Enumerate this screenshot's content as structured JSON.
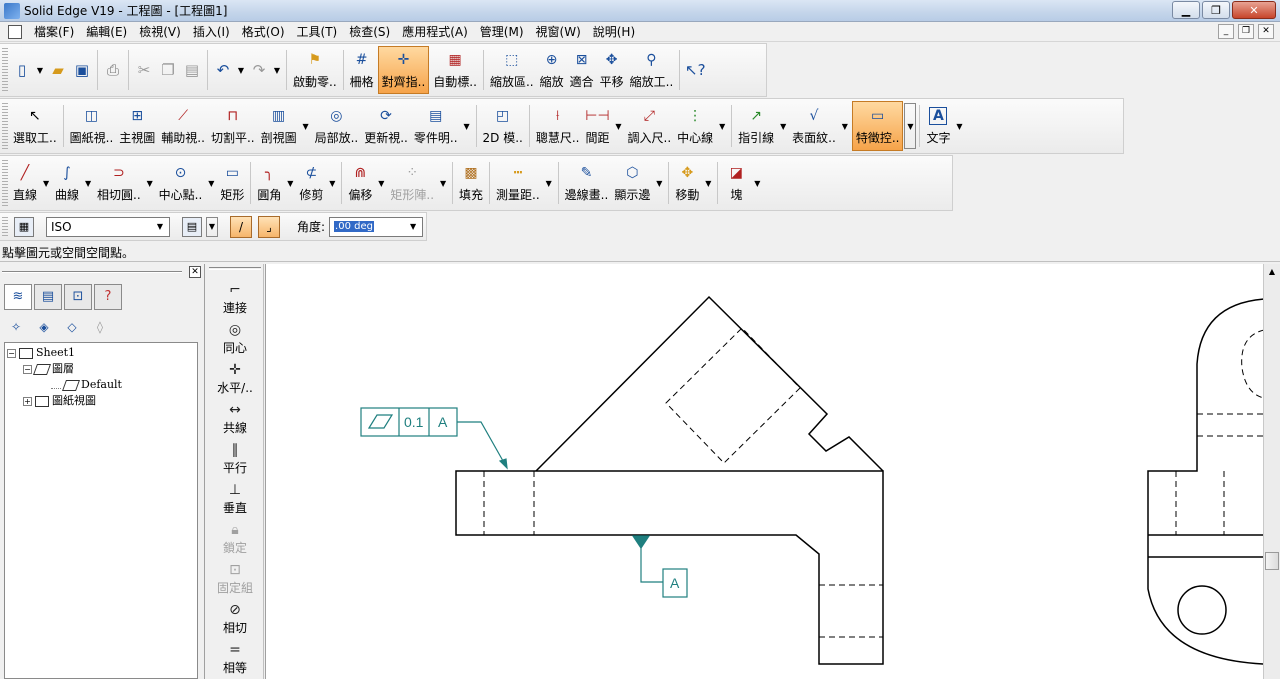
{
  "window": {
    "title": "Solid Edge V19 - 工程圖 - [工程圖1]"
  },
  "menu": [
    "檔案(F)",
    "編輯(E)",
    "檢視(V)",
    "插入(I)",
    "格式(O)",
    "工具(T)",
    "檢查(S)",
    "應用程式(A)",
    "管理(M)",
    "視窗(W)",
    "說明(H)"
  ],
  "toolbar1": {
    "buttons": [
      {
        "label": "啟動零..",
        "icon": "flag-icon"
      },
      {
        "label": "柵格",
        "icon": "grid-icon"
      },
      {
        "label": "對齊指..",
        "icon": "align-indicator-icon",
        "active": true
      },
      {
        "label": "自動標..",
        "icon": "auto-label-icon"
      },
      {
        "label": "縮放區..",
        "icon": "zoom-area-icon"
      },
      {
        "label": "縮放",
        "icon": "zoom-icon"
      },
      {
        "label": "適合",
        "icon": "fit-icon"
      },
      {
        "label": "平移",
        "icon": "pan-icon"
      },
      {
        "label": "縮放工..",
        "icon": "zoom-tool-icon"
      }
    ]
  },
  "toolbar2": {
    "buttons": [
      {
        "label": "選取工..",
        "icon": "select-tool-icon"
      },
      {
        "label": "圖紙視..",
        "icon": "drawing-view-icon"
      },
      {
        "label": "主視圖",
        "icon": "principal-view-icon"
      },
      {
        "label": "輔助視..",
        "icon": "auxiliary-view-icon"
      },
      {
        "label": "切割平..",
        "icon": "cutting-plane-icon"
      },
      {
        "label": "剖視圖",
        "icon": "section-view-icon"
      },
      {
        "label": "局部放..",
        "icon": "detail-view-icon"
      },
      {
        "label": "更新視..",
        "icon": "update-view-icon"
      },
      {
        "label": "零件明..",
        "icon": "parts-list-icon"
      },
      {
        "label": "2D 模..",
        "icon": "2d-model-icon"
      },
      {
        "label": "聰慧尺..",
        "icon": "smart-dimension-icon"
      },
      {
        "label": "間距",
        "icon": "distance-icon"
      },
      {
        "label": "調入尺..",
        "icon": "retrieve-dimension-icon"
      },
      {
        "label": "中心線",
        "icon": "center-line-icon"
      },
      {
        "label": "指引線",
        "icon": "leader-icon"
      },
      {
        "label": "表面紋..",
        "icon": "surface-texture-icon"
      },
      {
        "label": "特徵控..",
        "icon": "feature-control-icon",
        "active": true
      },
      {
        "label": "文字",
        "icon": "text-icon"
      }
    ]
  },
  "toolbar3": {
    "buttons": [
      {
        "label": "直線",
        "icon": "line-icon"
      },
      {
        "label": "曲線",
        "icon": "curve-icon"
      },
      {
        "label": "相切圓..",
        "icon": "tangent-arc-icon"
      },
      {
        "label": "中心點..",
        "icon": "center-point-icon"
      },
      {
        "label": "矩形",
        "icon": "rectangle-icon"
      },
      {
        "label": "圓角",
        "icon": "fillet-icon"
      },
      {
        "label": "修剪",
        "icon": "trim-icon"
      },
      {
        "label": "偏移",
        "icon": "offset-icon"
      },
      {
        "label": "矩形陣..",
        "icon": "rectangular-pattern-icon",
        "disabled": true
      },
      {
        "label": "填充",
        "icon": "fill-icon"
      },
      {
        "label": "測量距..",
        "icon": "measure-distance-icon"
      },
      {
        "label": "邊線畫..",
        "icon": "edge-painter-icon"
      },
      {
        "label": "顯示邊",
        "icon": "show-edges-icon"
      },
      {
        "label": "移動",
        "icon": "move-icon"
      },
      {
        "label": "塊",
        "icon": "block-icon"
      }
    ]
  },
  "ribbon": {
    "style_value": "ISO",
    "angle_label": "角度:",
    "angle_value": ".00 deg"
  },
  "prompt": "點擊圖元或空間空間點。",
  "tree": {
    "root": "Sheet1",
    "layers": "圖層",
    "default": "Default",
    "views": "圖紙視圖"
  },
  "relationships": [
    {
      "label": "連接",
      "icon": "connect-icon"
    },
    {
      "label": "同心",
      "icon": "concentric-icon"
    },
    {
      "label": "水平/..",
      "icon": "horizontal-vertical-icon"
    },
    {
      "label": "共線",
      "icon": "collinear-icon"
    },
    {
      "label": "平行",
      "icon": "parallel-icon"
    },
    {
      "label": "垂直",
      "icon": "perpendicular-icon"
    },
    {
      "label": "鎖定",
      "icon": "lock-icon",
      "disabled": true
    },
    {
      "label": "固定組",
      "icon": "rigid-set-icon",
      "disabled": true
    },
    {
      "label": "相切",
      "icon": "tangent-icon"
    },
    {
      "label": "相等",
      "icon": "equal-icon"
    }
  ],
  "drawing": {
    "fcf_tolerance": "0.1",
    "fcf_datum": "A",
    "datum_label": "A",
    "line_color": "#000000",
    "annotation_color": "#1f7f7f"
  }
}
